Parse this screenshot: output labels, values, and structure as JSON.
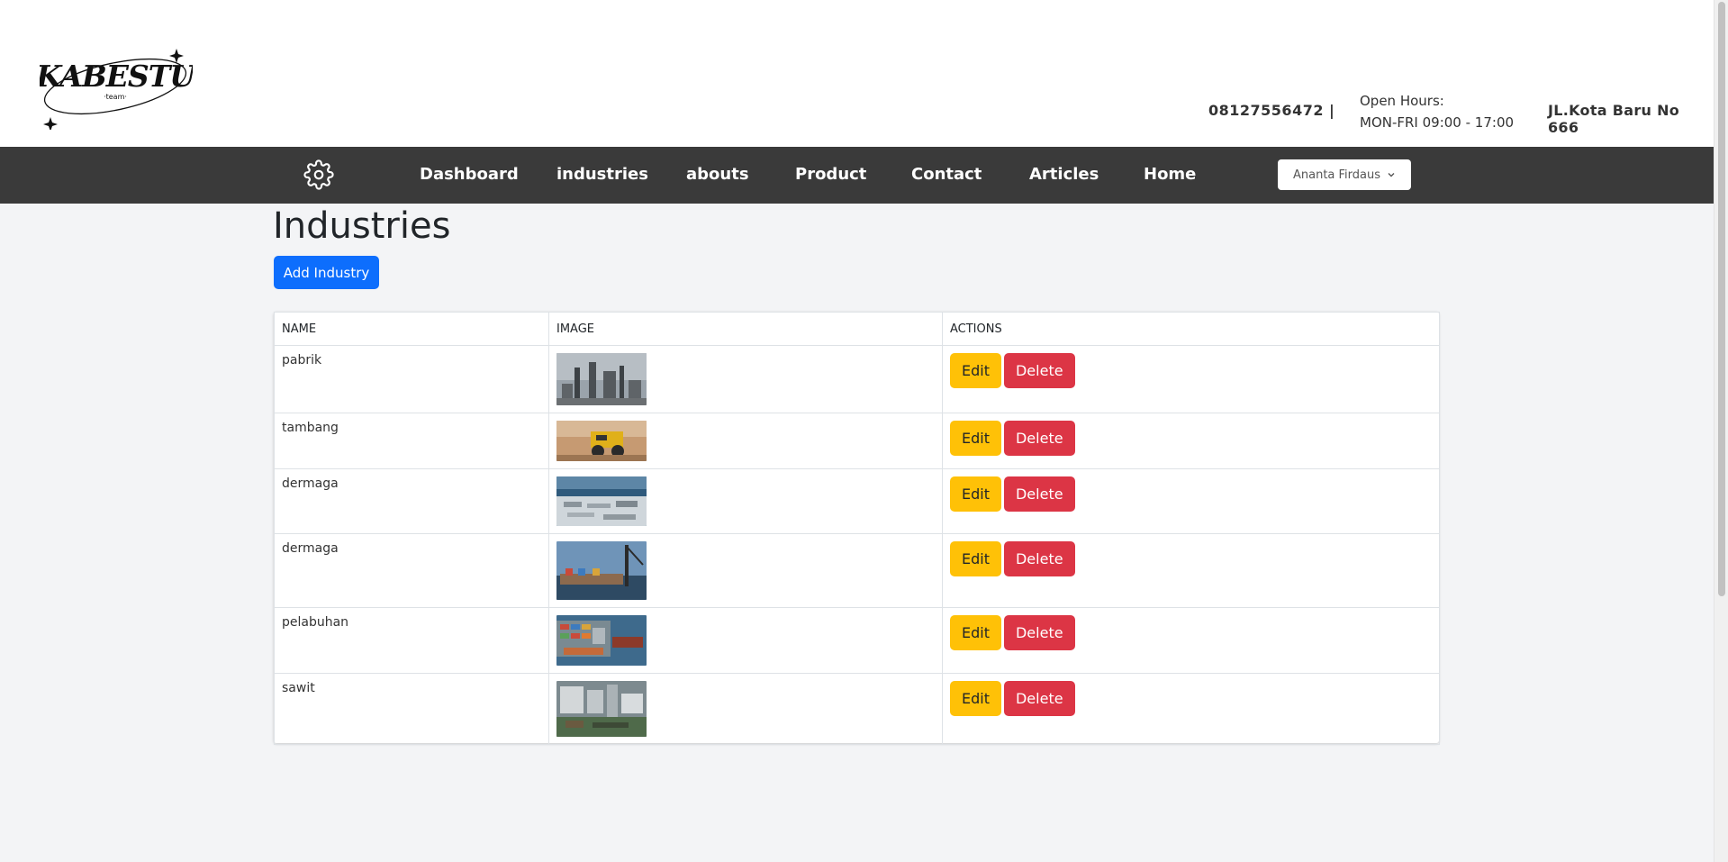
{
  "header": {
    "logo_text": "KABESTU",
    "logo_subtext": "team",
    "phone": "08127556472  |",
    "hours_label": "Open Hours:",
    "hours_value": "MON-FRI 09:00 - 17:00",
    "address": "JL.Kota Baru No 666"
  },
  "nav": {
    "icon": "gear-icon",
    "links": [
      "Dashboard",
      "industries",
      "abouts",
      "Product",
      "Contact",
      "Articles",
      "Home"
    ],
    "user": "Ananta Firdaus"
  },
  "page": {
    "title": "Industries",
    "add_button": "Add Industry"
  },
  "table": {
    "headers": [
      "NAME",
      "IMAGE",
      "ACTIONS"
    ],
    "rows": [
      {
        "name": "pabrik",
        "image": "factory-photo"
      },
      {
        "name": "tambang",
        "image": "mining-truck-photo"
      },
      {
        "name": "dermaga",
        "image": "port-aerial-photo"
      },
      {
        "name": "dermaga",
        "image": "dock-crane-photo"
      },
      {
        "name": "pelabuhan",
        "image": "container-port-photo"
      },
      {
        "name": "sawit",
        "image": "palm-oil-mill-photo"
      }
    ],
    "edit_label": "Edit",
    "delete_label": "Delete"
  },
  "colors": {
    "navbar": "#3a3a3a",
    "primary": "#0d6efd",
    "warning": "#ffc107",
    "danger": "#dc3545",
    "background": "#f3f4f6"
  }
}
